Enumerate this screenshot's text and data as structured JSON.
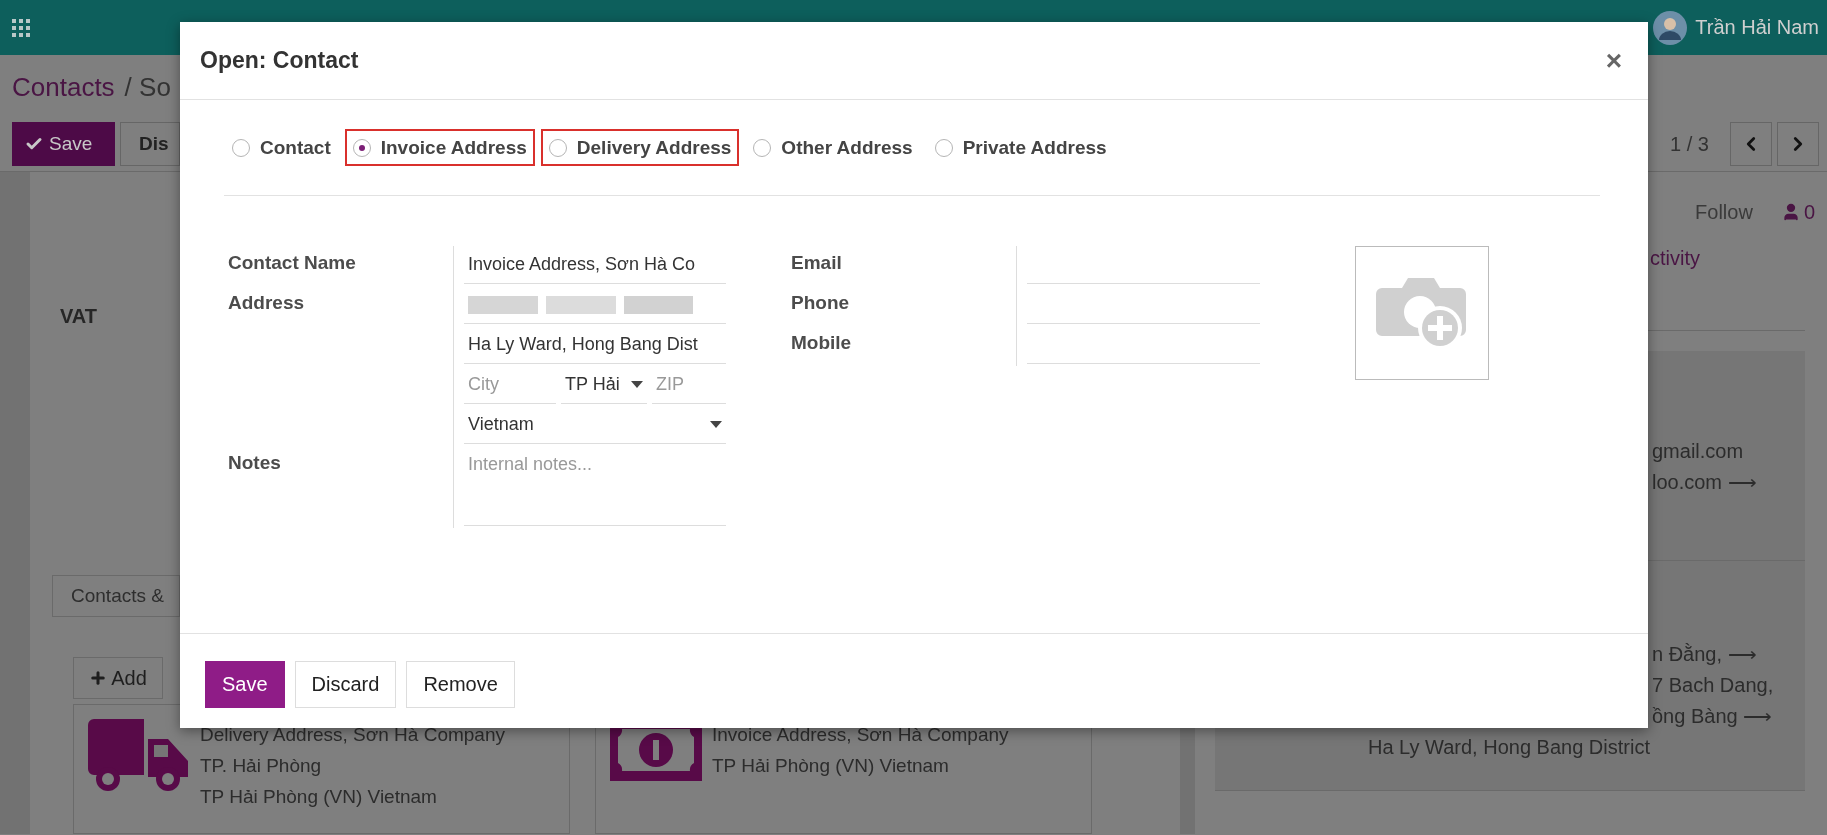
{
  "topbar": {
    "user": "Trần Hải Nam"
  },
  "breadcrumb": {
    "root": "Contacts",
    "current": "/ So"
  },
  "toolbar": {
    "buttons": [
      {
        "label": "Save",
        "kind": "save"
      },
      {
        "label": "Dis",
        "kind": "discard"
      }
    ],
    "pager": "1 / 3"
  },
  "sheet": {
    "field_label": "VAT",
    "tab": "Contacts &",
    "add_button": "Add",
    "cards": [
      {
        "kind": "delivery",
        "lines": [
          "Delivery Address, Sơn Hà Company",
          "TP. Hải Phòng",
          "TP Hải Phòng (VN) Vietnam"
        ]
      },
      {
        "kind": "invoice",
        "lines": [
          "Invoice Address, Sơn Hà Company",
          "TP Hải Phòng (VN) Vietnam"
        ]
      }
    ]
  },
  "chatter": {
    "follow": "Follow",
    "followers": "0",
    "activity": "ctivity",
    "boxes": [
      {
        "lines": [
          "gmail.com",
          "loo.com ⟶"
        ]
      },
      {
        "lines": [
          "n Đằng, ⟶",
          "7 Bach Dang,",
          "ồng Bàng ⟶"
        ],
        "last_line": "Ha Ly Ward, Hong Bang District"
      }
    ]
  },
  "dialog": {
    "title": "Open: Contact",
    "close": "×",
    "address_types": [
      {
        "label": "Contact",
        "selected": false,
        "highlighted": false
      },
      {
        "label": "Invoice Address",
        "selected": true,
        "highlighted": true
      },
      {
        "label": "Delivery Address",
        "selected": false,
        "highlighted": true
      },
      {
        "label": "Other Address",
        "selected": false,
        "highlighted": false
      },
      {
        "label": "Private Address",
        "selected": false,
        "highlighted": false
      }
    ],
    "left_rows": [
      {
        "label": "Contact Name",
        "fields": [
          {
            "kind": "input",
            "value": "Invoice Address, Sơn Hà Co"
          }
        ]
      },
      {
        "label": "Address",
        "fields": [
          {
            "kind": "redacted"
          }
        ]
      },
      {
        "fields": [
          {
            "kind": "input",
            "value": "Ha Ly Ward, Hong Bang Dist"
          }
        ]
      },
      {
        "fields": [
          {
            "kind": "input",
            "placeholder": "City"
          },
          {
            "kind": "select",
            "value": "TP Hải"
          },
          {
            "kind": "input",
            "placeholder": "ZIP"
          }
        ]
      },
      {
        "fields": [
          {
            "kind": "select",
            "value": "Vietnam"
          }
        ]
      },
      {
        "label": "Notes",
        "fields": [
          {
            "kind": "textarea",
            "placeholder": "Internal notes..."
          }
        ]
      }
    ],
    "right_rows": [
      {
        "label": "Email"
      },
      {
        "label": "Phone"
      },
      {
        "label": "Mobile"
      }
    ],
    "buttons": [
      {
        "label": "Save",
        "kind": "primary"
      },
      {
        "label": "Discard",
        "kind": "secondary"
      },
      {
        "label": "Remove",
        "kind": "secondary"
      }
    ]
  }
}
